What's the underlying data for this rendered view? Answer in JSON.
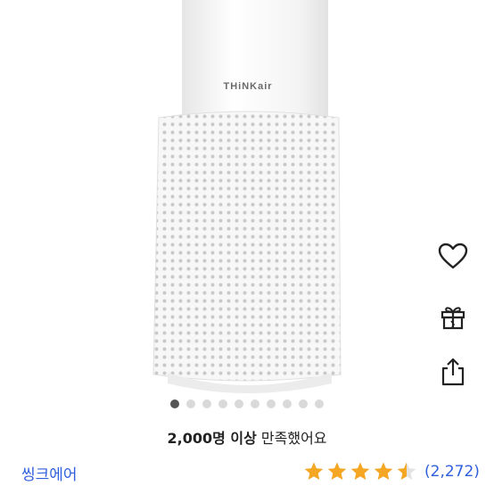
{
  "product": {
    "image_brand_text": "THiNKair"
  },
  "actions": [
    {
      "name": "wishlist-heart-icon"
    },
    {
      "name": "gift-icon"
    },
    {
      "name": "share-icon"
    }
  ],
  "carousel": {
    "total": 10,
    "active_index": 0
  },
  "satisfaction": {
    "bold": "2,000명 이상",
    "text": " 만족했어요"
  },
  "brand": {
    "name": "씽크에어"
  },
  "rating": {
    "value": 4.5,
    "max": 5,
    "count_label": "(2,272)",
    "star_color": "#f5a623"
  },
  "colors": {
    "link": "#2f5fdc"
  }
}
